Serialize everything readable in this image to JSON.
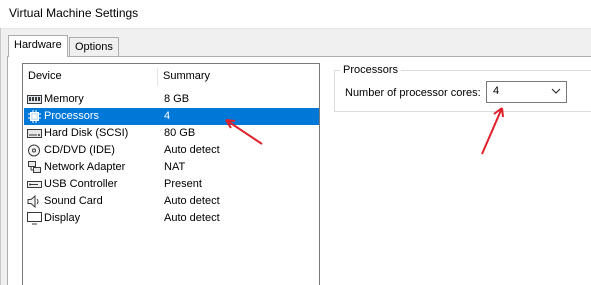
{
  "window": {
    "title": "Virtual Machine Settings"
  },
  "tabs": [
    {
      "label": "Hardware",
      "active": true
    },
    {
      "label": "Options",
      "active": false
    }
  ],
  "device_list": {
    "headers": {
      "device": "Device",
      "summary": "Summary"
    },
    "rows": [
      {
        "device": "Memory",
        "summary": "8 GB",
        "icon": "memory-icon",
        "selected": false
      },
      {
        "device": "Processors",
        "summary": "4",
        "icon": "processor-icon",
        "selected": true
      },
      {
        "device": "Hard Disk (SCSI)",
        "summary": "80 GB",
        "icon": "hard-disk-icon",
        "selected": false
      },
      {
        "device": "CD/DVD (IDE)",
        "summary": "Auto detect",
        "icon": "cd-dvd-icon",
        "selected": false
      },
      {
        "device": "Network Adapter",
        "summary": "NAT",
        "icon": "network-adapter-icon",
        "selected": false
      },
      {
        "device": "USB Controller",
        "summary": "Present",
        "icon": "usb-icon",
        "selected": false
      },
      {
        "device": "Sound Card",
        "summary": "Auto detect",
        "icon": "sound-card-icon",
        "selected": false
      },
      {
        "device": "Display",
        "summary": "Auto detect",
        "icon": "display-icon",
        "selected": false
      }
    ]
  },
  "processors_panel": {
    "group_title": "Processors",
    "cores_label": "Number of processor cores:",
    "cores_value": "4"
  },
  "colors": {
    "selection": "#0078d7",
    "annotation_arrow": "#e0202a"
  }
}
